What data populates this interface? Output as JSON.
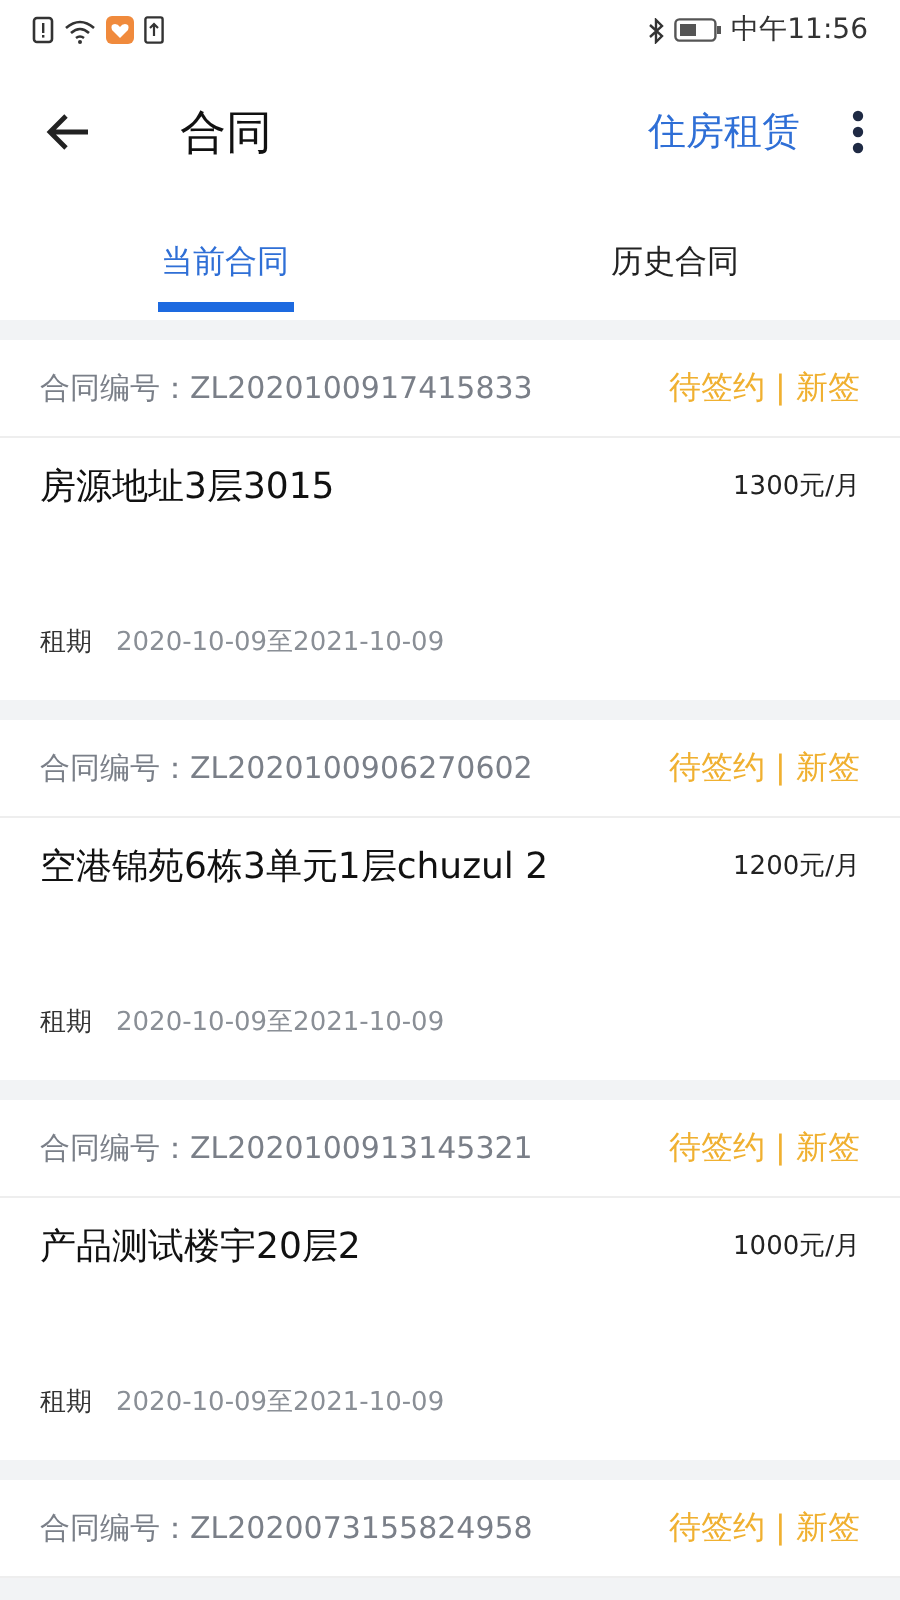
{
  "status_bar": {
    "time": "中午11:56"
  },
  "header": {
    "title": "合同",
    "action": "住房租赁"
  },
  "tabs": [
    {
      "label": "当前合同",
      "selected": true
    },
    {
      "label": "历史合同",
      "selected": false
    }
  ],
  "contracts": [
    {
      "number_label": "合同编号：",
      "number": "ZL2020100917415833",
      "status": "待签约 | 新签",
      "address": "房源地址3层3015",
      "rent": "1300元/月",
      "period_label": "租期",
      "period": "2020-10-09至2021-10-09"
    },
    {
      "number_label": "合同编号：",
      "number": "ZL2020100906270602",
      "status": "待签约 | 新签",
      "address": "空港锦苑6栋3单元1层chuzul 2",
      "rent": "1200元/月",
      "period_label": "租期",
      "period": "2020-10-09至2021-10-09"
    },
    {
      "number_label": "合同编号：",
      "number": "ZL2020100913145321",
      "status": "待签约 | 新签",
      "address": "产品测试楼宇20层2",
      "rent": "1000元/月",
      "period_label": "租期",
      "period": "2020-10-09至2021-10-09"
    },
    {
      "number_label": "合同编号：",
      "number": "ZL2020073155824958",
      "status": "待签约 | 新签"
    }
  ]
}
